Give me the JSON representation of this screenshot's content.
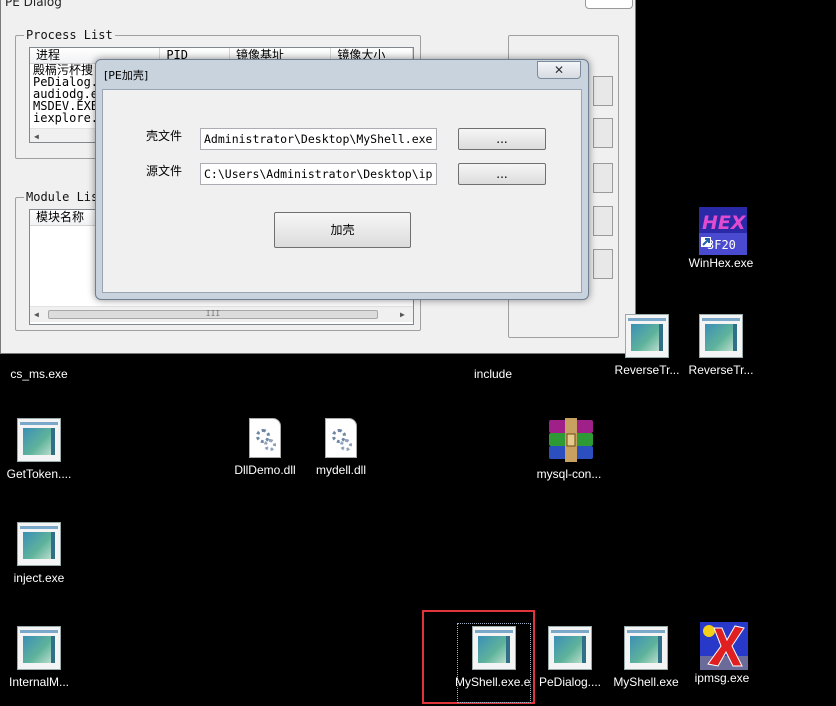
{
  "back_dialog": {
    "title": "PE Dialog",
    "process_group": "Process List",
    "process_columns": [
      "进程",
      "PID",
      "镜像基址",
      "镜像大小"
    ],
    "processes": [
      "殿槅污杯捜",
      "PeDialog.",
      "audiodg.e",
      "MSDEV.EXE",
      "iexplore."
    ],
    "module_group": "Module List",
    "module_columns": [
      "模块名称"
    ],
    "scroll_grip": "III"
  },
  "shell_dialog": {
    "title": "[PE加壳]",
    "close_glyph": "✕",
    "shell_label": "壳文件",
    "shell_value": "Administrator\\Desktop\\MyShell.exe",
    "source_label": "源文件",
    "source_value": "C:\\Users\\Administrator\\Desktop\\ip",
    "browse_label": "...",
    "add_shell_label": "加壳"
  },
  "desktop": {
    "icons": [
      {
        "label": "WinHex.exe",
        "icon": "winhex-icon"
      },
      {
        "label": "cs_ms.exe",
        "icon": "exe-icon"
      },
      {
        "label": "include",
        "icon": "folder-icon"
      },
      {
        "label": "ReverseTr...",
        "icon": "exe-icon"
      },
      {
        "label": "ReverseTr...",
        "icon": "exe-icon"
      },
      {
        "label": "GetToken....",
        "icon": "exe-icon"
      },
      {
        "label": "DllDemo.dll",
        "icon": "dll-icon"
      },
      {
        "label": "mydell.dll",
        "icon": "dll-icon"
      },
      {
        "label": "mysql-con...",
        "icon": "winrar-icon"
      },
      {
        "label": "inject.exe",
        "icon": "exe-icon"
      },
      {
        "label": "InternalM...",
        "icon": "exe-icon"
      },
      {
        "label": "MyShell.exe.exe",
        "icon": "exe-icon"
      },
      {
        "label": "PeDialog....",
        "icon": "exe-icon"
      },
      {
        "label": "MyShell.exe",
        "icon": "exe-icon"
      },
      {
        "label": "ipmsg.exe",
        "icon": "ipmsg-icon"
      }
    ]
  },
  "colors": {
    "desktop": "#000000",
    "selection": "#e0343a",
    "dialog_frame": "#c9d3de"
  }
}
